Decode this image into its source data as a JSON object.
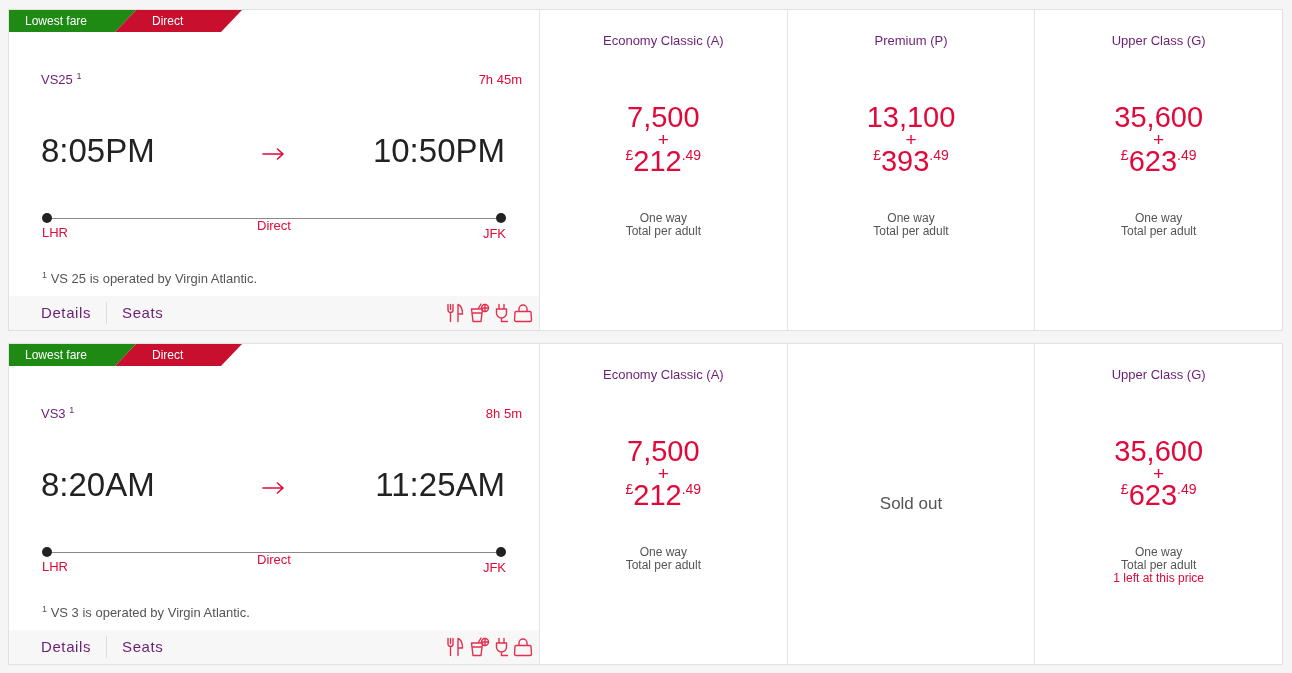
{
  "flights": [
    {
      "tags": [
        {
          "label": "Lowest fare",
          "color": "#1e8a14"
        },
        {
          "label": "Direct",
          "color": "#c8102e"
        }
      ],
      "flight_number": "VS25 $^{1}$",
      "duration": "7h 45m",
      "departure_time": "8:05PM",
      "arrival_time": "10:50PM",
      "origin": "LHR",
      "route": "Direct",
      "destination": "JFK",
      "footnote": "$^{1}$ VS 25 is operated by Virgin Atlantic.",
      "links": [
        "Details",
        "Seats"
      ],
      "fares": [
        {
          "kind": "price",
          "cabin": "Economy Classic (A)",
          "points": "7,500",
          "plus": "+",
          "cash": "$^{£}$212$^{.49}$",
          "trip": "One way",
          "basis": "Total per adult"
        },
        {
          "kind": "price",
          "cabin": "Premium (P)",
          "points": "13,100",
          "plus": "+",
          "cash": "$^{£}$393$^{.49}$",
          "trip": "One way",
          "basis": "Total per adult"
        },
        {
          "kind": "price",
          "cabin": "Upper Class (G)",
          "points": "35,600",
          "plus": "+",
          "cash": "$^{£}$623$^{.49}$",
          "trip": "One way",
          "basis": "Total per adult"
        }
      ]
    },
    {
      "tags": [
        {
          "label": "Lowest fare",
          "color": "#1e8a14"
        },
        {
          "label": "Direct",
          "color": "#c8102e"
        }
      ],
      "flight_number": "VS3 $^{1}$",
      "duration": "8h 5m",
      "departure_time": "8:20AM",
      "arrival_time": "11:25AM",
      "origin": "LHR",
      "route": "Direct",
      "destination": "JFK",
      "footnote": "$^{1}$ VS 3 is operated by Virgin Atlantic.",
      "links": [
        "Details",
        "Seats"
      ],
      "fares": [
        {
          "kind": "price",
          "cabin": "Economy Classic (A)",
          "points": "7,500",
          "plus": "+",
          "cash": "$^{£}$212$^{.49}$",
          "trip": "One way",
          "basis": "Total per adult"
        },
        {
          "kind": "sold_out",
          "label": "Sold out"
        },
        {
          "kind": "price",
          "cabin": "Upper Class (G)",
          "points": "35,600",
          "plus": "+",
          "cash": "$^{£}$623$^{.49}$",
          "trip": "One way",
          "basis": "Total per adult",
          "availability": "1 left at this price"
        }
      ]
    }
  ]
}
